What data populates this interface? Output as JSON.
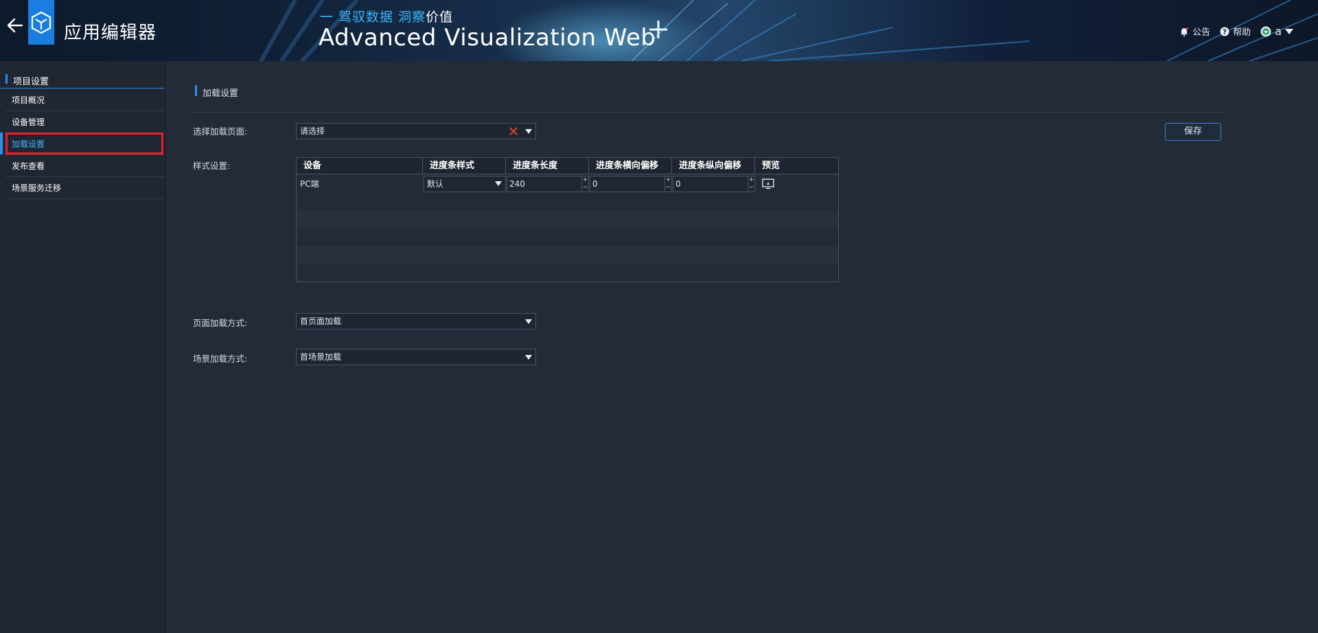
{
  "header": {
    "app_title": "应用编辑器",
    "slogan_part1": "一 驾驭数据 ",
    "slogan_part2": "洞察",
    "slogan_part3": "价值",
    "brand": "Advanced Visualization Web",
    "notice_label": "公告",
    "help_label": "帮助",
    "user_name": "a",
    "icons": [
      "back-arrow-icon",
      "app-logo-icon",
      "bell-icon",
      "help-icon",
      "user-icon",
      "chevron-down-icon"
    ]
  },
  "sidebar": {
    "group_title": "项目设置",
    "items": [
      {
        "label": "项目概况"
      },
      {
        "label": "设备管理"
      },
      {
        "label": "加载设置"
      },
      {
        "label": "发布查看"
      },
      {
        "label": "场景服务迁移"
      }
    ],
    "active_index": 2
  },
  "main": {
    "panel_title": "加载设置",
    "select_page_label": "选择加载页面:",
    "select_page_value": "请选择",
    "save_label": "保存",
    "style_label": "样式设置:",
    "table": {
      "columns": [
        "设备",
        "进度条样式",
        "进度条长度",
        "进度条横向偏移",
        "进度条纵向偏移",
        "预览"
      ],
      "rows": [
        {
          "device": "PC端",
          "style": "默认",
          "length": "240",
          "h_offset": "0",
          "v_offset": "0"
        }
      ]
    },
    "page_load_label": "页面加载方式:",
    "page_load_value": "首页面加载",
    "scene_load_label": "场景加载方式:",
    "scene_load_value": "首场景加载"
  },
  "colors": {
    "accent": "#2c8ff0",
    "active_text": "#3cb9ff",
    "highlight_box": "#e8222c",
    "background": "#232b38",
    "clear_icon": "#e23c2c"
  }
}
